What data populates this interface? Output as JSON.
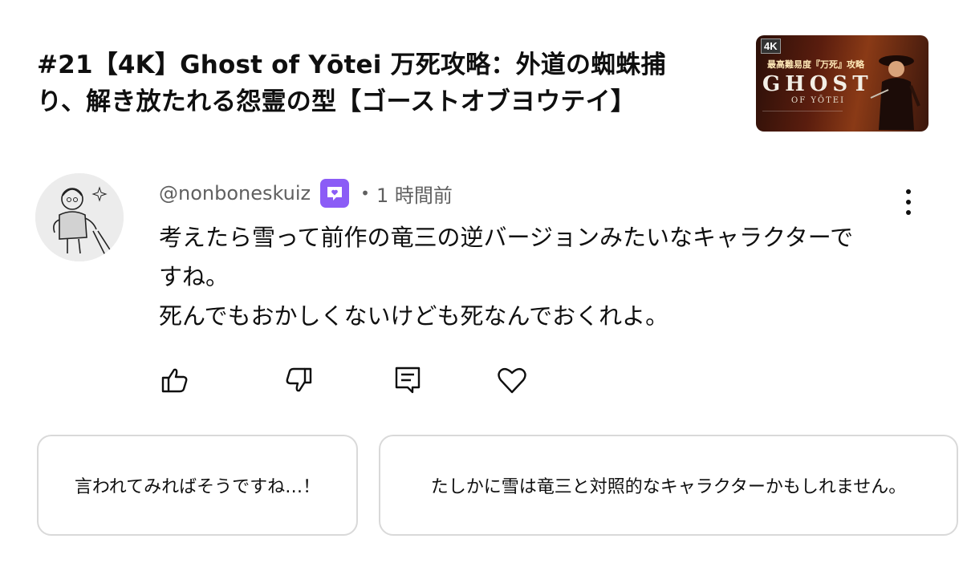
{
  "video": {
    "title_line1": "#21【4K】Ghost of Yōtei 万死攻略：外道の蜘蛛捕",
    "title_line2": "り、解き放たれる怨霊の型【ゴーストオブヨウテイ】",
    "thumbnail": {
      "badge": "4K",
      "subtitle": "最高難易度『万死』攻略",
      "logo": "GHOST",
      "logo_sub": "OF YŌTEI"
    }
  },
  "comment": {
    "author": "@nonboneskuiz",
    "member_badge_icon": "member-badge-icon",
    "separator": "•",
    "time": "1 時間前",
    "lines": [
      "考えたら雪って前作の竜三の逆バージョンみたいなキャラクターで",
      "すね。",
      "死んでもおかしくないけども死なんでおくれよ。"
    ]
  },
  "actions": [
    "thumbs-up-icon",
    "thumbs-down-icon",
    "reply-icon",
    "heart-icon"
  ],
  "suggested_replies": [
    "言われてみればそうですね…！",
    "たしかに雪は竜三と対照的なキャラクターかもしれません。"
  ],
  "colors": {
    "badge": "#8b5cf6",
    "meta_text": "#606060",
    "card_border": "#d9d9d9"
  }
}
